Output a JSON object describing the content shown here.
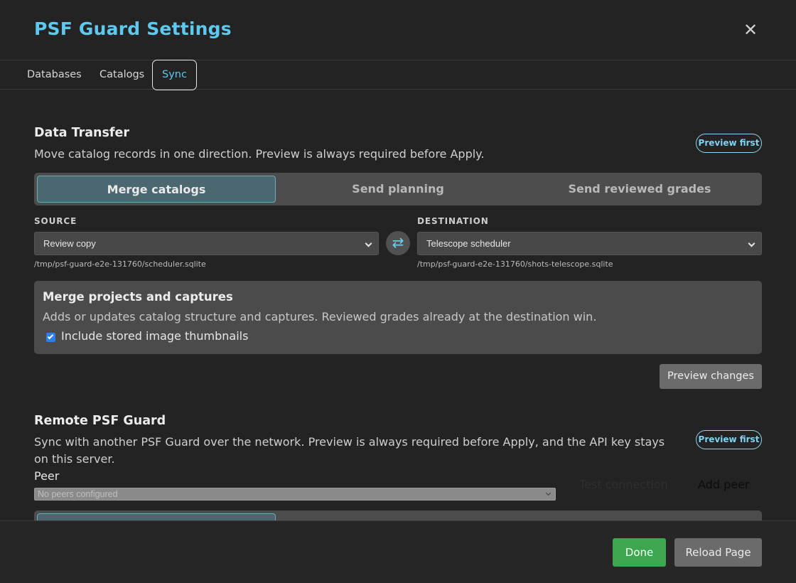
{
  "dialog": {
    "title": "PSF Guard Settings",
    "close_icon": "close-icon"
  },
  "tabs": [
    {
      "label": "Databases",
      "active": false
    },
    {
      "label": "Catalogs",
      "active": false
    },
    {
      "label": "Sync",
      "active": true
    }
  ],
  "transfer": {
    "title": "Data Transfer",
    "description": "Move catalog records in one direction. Preview is always required before Apply.",
    "badge": "Preview first",
    "modes": [
      {
        "label": "Merge catalogs",
        "active": true
      },
      {
        "label": "Send planning",
        "active": false
      },
      {
        "label": "Send reviewed grades",
        "active": false
      }
    ],
    "source": {
      "label": "SOURCE",
      "value": "Review copy",
      "path": "/tmp/psf-guard-e2e-131760/scheduler.sqlite"
    },
    "swap_icon": "swap-arrows-icon",
    "destination": {
      "label": "DESTINATION",
      "value": "Telescope scheduler",
      "path": "/tmp/psf-guard-e2e-131760/shots-telescope.sqlite"
    },
    "card": {
      "title": "Merge projects and captures",
      "description": "Adds or updates catalog structure and captures. Reviewed grades already at the destination win.",
      "checkbox_label": "Include stored image thumbnails",
      "checked": true
    },
    "preview_button": "Preview changes"
  },
  "remote": {
    "title": "Remote PSF Guard",
    "description": "Sync with another PSF Guard over the network. Preview is always required before Apply, and the API key stays on this server.",
    "badge": "Preview first",
    "peer_label": "Peer",
    "peer_placeholder": "No peers configured",
    "test_button": "Test connection",
    "add_button": "Add peer"
  },
  "footer": {
    "done": "Done",
    "reload": "Reload Page"
  },
  "colors": {
    "accent": "#5ec8ef",
    "done": "#3da74f",
    "panel": "#4b4b4b",
    "background": "#232323"
  }
}
